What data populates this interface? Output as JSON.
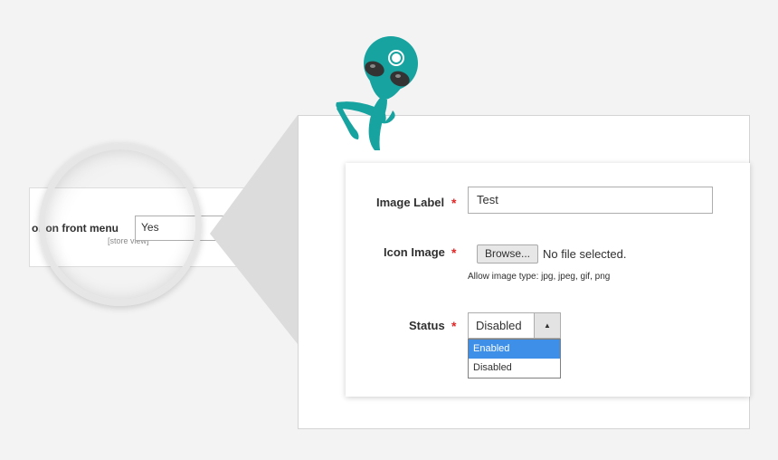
{
  "bg_form": {
    "row_label": "or on front menu",
    "scope": "[store view]",
    "value": "Yes"
  },
  "form": {
    "image_label": {
      "label": "Image Label",
      "value": "Test"
    },
    "icon_image": {
      "label": "Icon Image",
      "button": "Browse...",
      "file_status": "No file selected.",
      "hint": "Allow image type: jpg, jpeg, gif, png"
    },
    "status": {
      "label": "Status",
      "value": "Disabled",
      "arrow": "▲",
      "options": [
        "Enabled",
        "Disabled"
      ],
      "highlighted": "Enabled"
    },
    "required_mark": "*"
  },
  "colors": {
    "required": "#e22626",
    "highlight": "#3d8fe8",
    "alien": "#17a3a0"
  },
  "icons": {
    "mascot": "alien-mascot-icon"
  }
}
